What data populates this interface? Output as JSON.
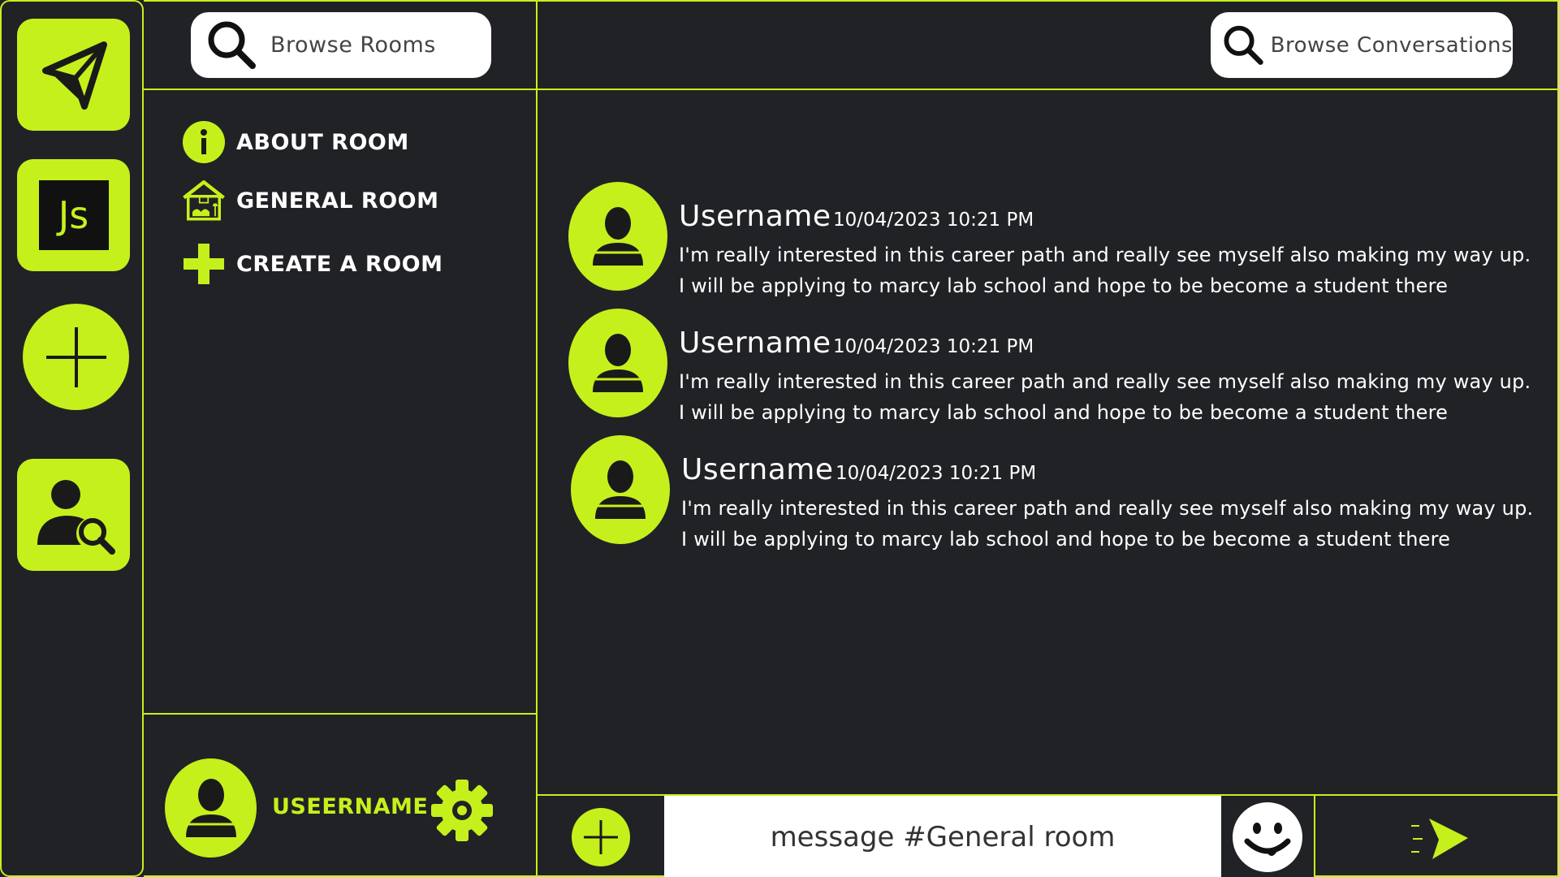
{
  "rooms_search": {
    "placeholder": "Browse Rooms"
  },
  "conversations_search": {
    "placeholder": "Browse Conversations"
  },
  "rail": {
    "items": [
      {
        "name": "send-icon"
      },
      {
        "name": "javascript-icon",
        "label": "Js"
      },
      {
        "name": "add-icon"
      },
      {
        "name": "user-search-icon"
      }
    ]
  },
  "rooms": {
    "items": [
      {
        "label": "ABOUT ROOM",
        "icon": "info-icon"
      },
      {
        "label": "GENERAL ROOM",
        "icon": "home-icon"
      },
      {
        "label": "CREATE A ROOM",
        "icon": "plus-icon"
      }
    ]
  },
  "current_user": {
    "name": "USEERNAME"
  },
  "messages": [
    {
      "user": "Username",
      "time": "10/04/2023 10:21 PM",
      "line1": "I'm really interested in this career path and really see myself also making my way up.",
      "line2": "I will be applying to marcy lab school and hope to be become a student there"
    },
    {
      "user": "Username",
      "time": "10/04/2023 10:21 PM",
      "line1": "I'm really interested in this career path and really see myself also making my way up.",
      "line2": "I will be applying to marcy lab school and hope to be become a student there"
    },
    {
      "user": "Username",
      "time": "10/04/2023 10:21 PM",
      "line1": "I'm really interested in this career path and really see myself also making my way up.",
      "line2": "I will be applying to marcy lab school and hope to be become a student there"
    }
  ],
  "composer": {
    "placeholder": "message #General room"
  },
  "colors": {
    "accent": "#c6f01c",
    "background": "#212226",
    "white": "#ffffff"
  }
}
